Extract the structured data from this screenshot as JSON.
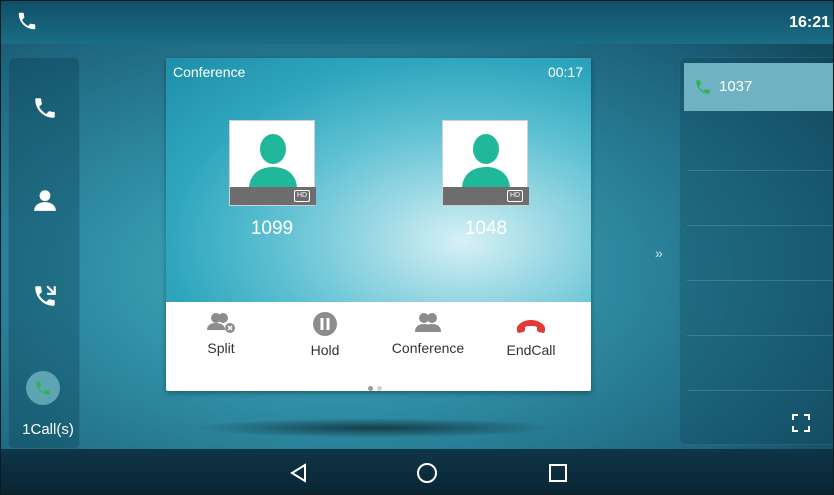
{
  "status_bar": {
    "time": "16:21"
  },
  "left_bar": {
    "items": [
      {
        "icon": "phone-icon"
      },
      {
        "icon": "contacts-icon"
      },
      {
        "icon": "call-history-icon"
      },
      {
        "icon": "active-call-icon"
      }
    ],
    "call_count": "1Call(s)"
  },
  "conference": {
    "title": "Conference",
    "duration": "00:17",
    "hd_label": "HD",
    "parties": [
      {
        "number": "1099"
      },
      {
        "number": "1048"
      }
    ],
    "actions": [
      {
        "label": "Split",
        "icon": "split-icon"
      },
      {
        "label": "Hold",
        "icon": "hold-icon"
      },
      {
        "label": "Conference",
        "icon": "conference-icon"
      },
      {
        "label": "EndCall",
        "icon": "end-call-icon"
      }
    ],
    "page_count": 2,
    "current_page": 1
  },
  "right_panel": {
    "lines": [
      {
        "number": "1037",
        "active": true
      }
    ]
  },
  "nav_bar": {
    "buttons": [
      "back-icon",
      "home-icon",
      "recents-icon"
    ]
  },
  "colors": {
    "accent_green": "#2fb35a",
    "end_call_red": "#e53935",
    "avatar_teal": "#1fb89a"
  }
}
